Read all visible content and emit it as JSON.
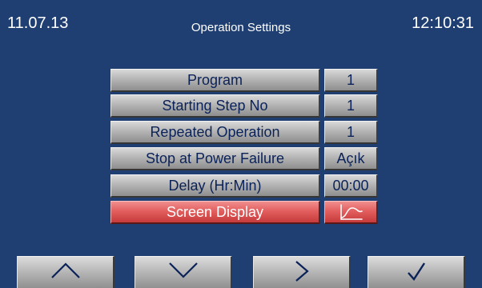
{
  "header": {
    "date": "11.07.13",
    "title": "Operation Settings",
    "time": "12:10:31"
  },
  "settings": [
    {
      "label": "Program",
      "value": "1"
    },
    {
      "label": "Starting Step No",
      "value": "1"
    },
    {
      "label": "Repeated Operation",
      "value": "1"
    },
    {
      "label": "Stop at Power Failure",
      "value": "Açık"
    },
    {
      "label": "Delay (Hr:Min)",
      "value": "00:00"
    },
    {
      "label": "Screen Display",
      "value_icon": "graph-curve-icon",
      "selected": true
    }
  ],
  "nav": [
    {
      "icon": "up-arrow-icon"
    },
    {
      "icon": "down-arrow-icon"
    },
    {
      "icon": "right-arrow-icon"
    },
    {
      "icon": "checkmark-icon"
    }
  ],
  "colors": {
    "background": "#1f3f72",
    "button_gray": "#b5b5b5",
    "button_selected": "#e35f5f",
    "button_text": "#0a2258"
  }
}
